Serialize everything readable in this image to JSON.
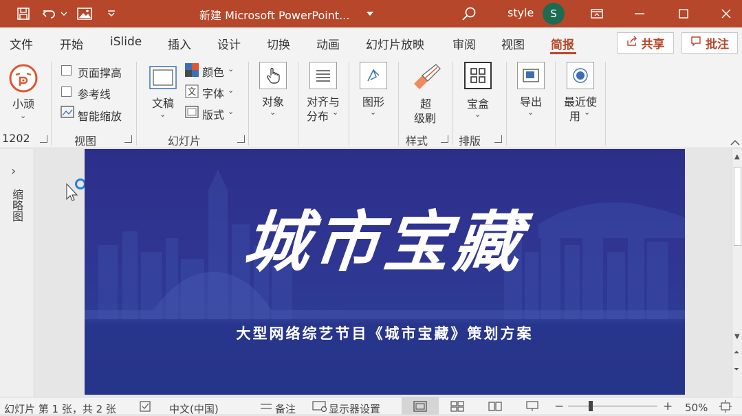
{
  "titlebar": {
    "doc_title": "新建 Microsoft PowerPoint...",
    "user_name": "style",
    "avatar_initial": "S",
    "accent": "#b7472a"
  },
  "tabs": [
    "文件",
    "开始",
    "iSlide",
    "插入",
    "设计",
    "切换",
    "动画",
    "幻灯片放映",
    "审阅",
    "视图",
    "简报"
  ],
  "active_tab": "简报",
  "actions": {
    "share": "共享",
    "comment": "批注"
  },
  "ribbon": {
    "xiaowan": {
      "label": "小顽"
    },
    "view_group": {
      "label": "视图",
      "items": [
        "页面撑高",
        "参考线",
        "智能缩放"
      ],
      "counter": "1202"
    },
    "slide_group": {
      "label": "幻灯片",
      "manuscript": "文稿",
      "color": "颜色",
      "font": "字体",
      "layout": "版式"
    },
    "object": "对象",
    "align": {
      "line1": "对齐与",
      "line2": "分布"
    },
    "shape": "图形",
    "style_group": {
      "label": "样式",
      "brush_line1": "超",
      "brush_line2": "级刷"
    },
    "layout_group": {
      "label": "排版",
      "box": "宝盒"
    },
    "export": "导出",
    "recent": {
      "line1": "最近使",
      "line2": "用"
    }
  },
  "left_panel": {
    "label": "缩略图"
  },
  "slide": {
    "title": "城市宝藏",
    "subtitle": "大型网络综艺节目《城市宝藏》策划方案",
    "bg_color": "#2f3591"
  },
  "statusbar": {
    "slide_info": "幻灯片 第 1 张，共 2 张",
    "language": "中文(中国)",
    "notes": "备注",
    "display_settings": "显示器设置",
    "zoom": "50%"
  }
}
